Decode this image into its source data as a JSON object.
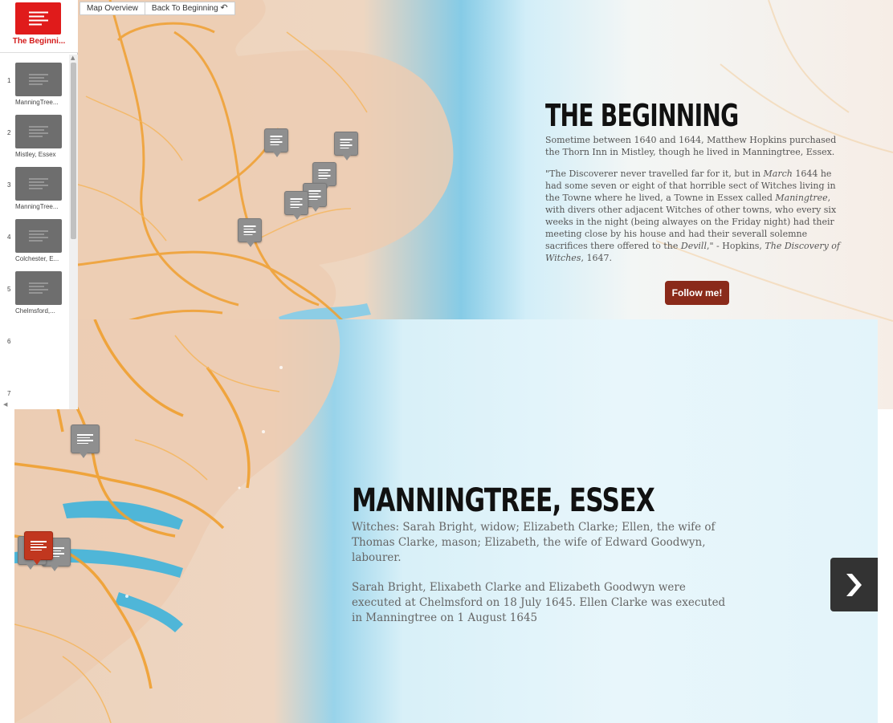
{
  "nav": {
    "map_overview": "Map Overview",
    "back_to_beginning": "Back To Beginning"
  },
  "cover": {
    "label": "The Beginni..."
  },
  "slides": [
    {
      "num": "1",
      "label": "ManningTree..."
    },
    {
      "num": "2",
      "label": "Mistley, Essex"
    },
    {
      "num": "3",
      "label": "ManningTree..."
    },
    {
      "num": "4",
      "label": "Colchester, E..."
    },
    {
      "num": "5",
      "label": "Chelmsford,..."
    },
    {
      "num": "6",
      "label": ""
    },
    {
      "num": "7",
      "label": ""
    }
  ],
  "top_panel": {
    "title": "THE BEGINNING",
    "para1": "Sometime between 1640 and 1644, Matthew Hopkins purchased the Thorn Inn in Mistley, though he lived in Manningtree, Essex.",
    "para2_a": "\"The Discoverer never travelled far for it, but in ",
    "para2_b": "March",
    "para2_c": " 1644 he had some seven or eight of that horrible sect of Witches living in the Towne where he lived, a Towne in Essex called ",
    "para2_d": "Maningtree",
    "para2_e": ", with divers other adjacent Witches of other towns, who every six weeks in the night (being alwayes on the Friday night) had their meeting close by his house and had their severall solemne sacrifices there offered to the ",
    "para2_f": "Devill",
    "para2_g": ",\" - Hopkins, ",
    "para2_h": "The Discovery of Witches",
    "para2_i": ", 1647.",
    "button": "Follow me!"
  },
  "bottom_panel": {
    "title": "MANNINGTREE, ESSEX",
    "para1": "Witches: Sarah Bright, widow; Elizabeth Clarke; Ellen, the wife of Thomas Clarke, mason; Elizabeth, the wife of Edward Goodwyn, labourer.",
    "para2": "Sarah Bright, Elixabeth Clarke and Elizabeth Goodwyn were executed at Chelmsford on 18 July 1645. Ellen Clarke was executed in Manningtree on 1 August 1645"
  },
  "colors": {
    "cover_red": "#e01b1b",
    "follow_button": "#8a2a1a",
    "active_pin": "#c1371f",
    "next_button": "#333333"
  }
}
